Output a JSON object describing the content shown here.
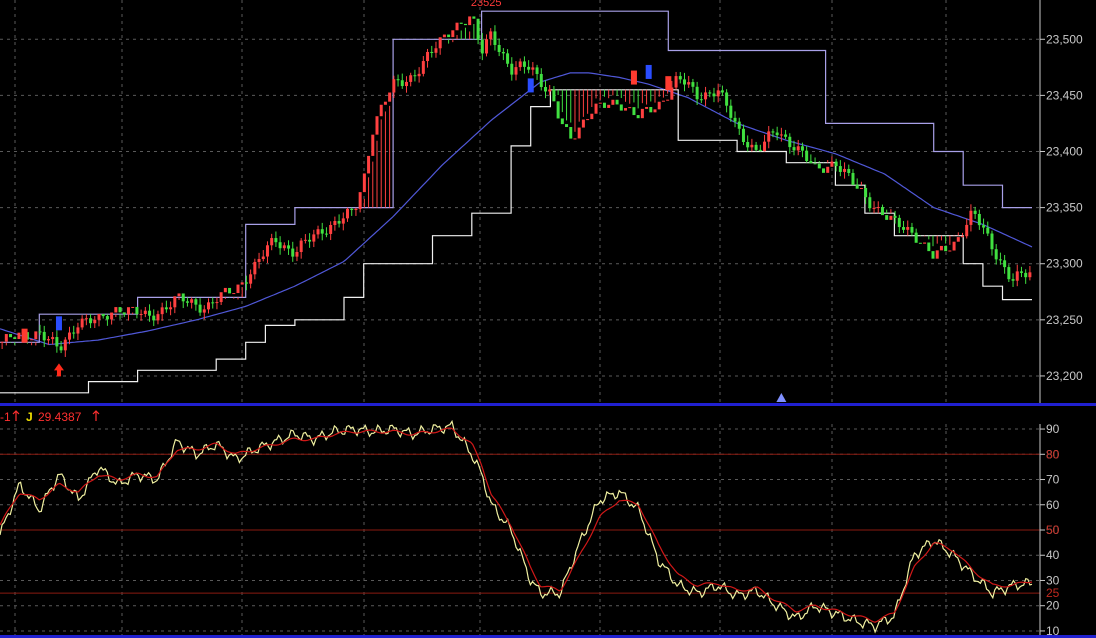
{
  "chart_data": [
    {
      "type": "candlestick",
      "panel": "price",
      "ylim": [
        23175,
        23535
      ],
      "yticks": [
        23200,
        23250,
        23300,
        23350,
        23400,
        23450,
        23500
      ],
      "ytick_labels": [
        "23,200",
        "23,250",
        "23,300",
        "23,350",
        "23,400",
        "23,450",
        "23,500"
      ],
      "x_range": [
        0,
        210
      ],
      "peak_label": "23525",
      "peak_point": [
        95,
        23525
      ],
      "series": [
        {
          "kind": "close_path",
          "x": [
            0,
            8,
            12,
            16,
            20,
            24,
            30,
            36,
            42,
            48,
            52,
            56,
            60,
            66,
            72,
            74,
            76,
            80,
            84,
            88,
            92,
            96,
            98,
            100,
            104,
            108,
            112,
            114,
            116,
            120,
            126,
            130,
            134,
            138,
            142,
            146,
            150,
            154,
            158,
            162,
            166,
            170,
            174,
            178,
            182,
            186,
            190,
            194,
            198,
            202,
            206,
            210
          ],
          "y": [
            23230,
            23240,
            23222,
            23250,
            23248,
            23262,
            23252,
            23268,
            23262,
            23278,
            23298,
            23322,
            23310,
            23332,
            23345,
            23375,
            23425,
            23458,
            23468,
            23488,
            23512,
            23518,
            23488,
            23508,
            23470,
            23478,
            23450,
            23425,
            23412,
            23435,
            23445,
            23430,
            23442,
            23465,
            23450,
            23455,
            23420,
            23400,
            23418,
            23405,
            23382,
            23392,
            23368,
            23352,
            23335,
            23328,
            23305,
            23318,
            23345,
            23315,
            23285,
            23292
          ]
        },
        {
          "kind": "upper_channel",
          "x": [
            0,
            8,
            28,
            50,
            60,
            80,
            98,
            132,
            136,
            166,
            168,
            190,
            196,
            204,
            210
          ],
          "y": [
            23230,
            23255,
            23270,
            23335,
            23350,
            23500,
            23525,
            23525,
            23490,
            23490,
            23425,
            23400,
            23370,
            23350,
            23350
          ]
        },
        {
          "kind": "lower_channel",
          "x": [
            0,
            18,
            28,
            44,
            50,
            54,
            60,
            70,
            74,
            88,
            96,
            104,
            108,
            112,
            114,
            138,
            148,
            150,
            160,
            170,
            176,
            182,
            196,
            200,
            204
          ],
          "y": [
            23185,
            23195,
            23205,
            23215,
            23230,
            23245,
            23250,
            23270,
            23300,
            23325,
            23345,
            23405,
            23440,
            23455,
            23455,
            23410,
            23410,
            23400,
            23390,
            23370,
            23345,
            23325,
            23300,
            23280,
            23268
          ]
        },
        {
          "kind": "moving_average",
          "x": [
            0,
            10,
            20,
            30,
            40,
            50,
            60,
            70,
            80,
            90,
            100,
            110,
            116,
            120,
            126,
            132,
            140,
            150,
            160,
            170,
            180,
            190,
            200,
            210
          ],
          "y": [
            23242,
            23228,
            23232,
            23240,
            23250,
            23262,
            23280,
            23302,
            23342,
            23388,
            23428,
            23462,
            23470,
            23470,
            23466,
            23460,
            23448,
            23425,
            23410,
            23398,
            23380,
            23350,
            23335,
            23315
          ]
        }
      ],
      "signals": [
        {
          "x": 5,
          "price": 23235,
          "color": "#ff3b30",
          "type": "bar"
        },
        {
          "x": 12,
          "price": 23246,
          "color": "#2a4dff",
          "type": "bar"
        },
        {
          "x": 12,
          "price": 23205,
          "color": "#ff2a1a",
          "type": "arrow"
        },
        {
          "x": 108,
          "price": 23458,
          "color": "#2a4dff",
          "type": "bar"
        },
        {
          "x": 129,
          "price": 23465,
          "color": "#ff3b30",
          "type": "bar"
        },
        {
          "x": 132,
          "price": 23470,
          "color": "#2a4dff",
          "type": "bar"
        },
        {
          "x": 136,
          "price": 23460,
          "color": "#ff3b30",
          "type": "bar"
        }
      ],
      "marker_x": 159
    },
    {
      "type": "line",
      "panel": "indicator",
      "ylim": [
        8,
        92
      ],
      "yticks": [
        10,
        20,
        30,
        40,
        50,
        60,
        70,
        80,
        90
      ],
      "ytick_labels": [
        "10",
        "20",
        "30",
        "40",
        "50",
        "60",
        "70",
        "80",
        "90"
      ],
      "reference_levels": [
        80,
        50,
        25
      ],
      "reference_labels": [
        "80",
        "50",
        "25"
      ],
      "x_range": [
        0,
        210
      ],
      "legend": [
        {
          "text": "-1",
          "color": "#ff3030"
        },
        {
          "text": "J",
          "color": "#f0e000"
        },
        {
          "text": "29.4387",
          "color": "#ff3030"
        }
      ],
      "series": [
        {
          "name": "J",
          "color": "#f0f0a0",
          "x": [
            0,
            4,
            8,
            12,
            16,
            20,
            24,
            28,
            32,
            36,
            40,
            44,
            48,
            52,
            56,
            60,
            64,
            68,
            72,
            76,
            80,
            84,
            88,
            92,
            96,
            98,
            100,
            104,
            108,
            110,
            114,
            118,
            122,
            126,
            130,
            134,
            138,
            142,
            146,
            150,
            154,
            158,
            162,
            166,
            170,
            174,
            178,
            182,
            186,
            190,
            194,
            198,
            202,
            206,
            210
          ],
          "y": [
            48,
            68,
            58,
            72,
            62,
            75,
            68,
            72,
            70,
            85,
            80,
            84,
            78,
            82,
            85,
            88,
            86,
            89,
            90,
            89,
            90,
            88,
            90,
            91,
            80,
            72,
            60,
            50,
            30,
            25,
            25,
            45,
            62,
            65,
            58,
            38,
            28,
            25,
            28,
            24,
            26,
            20,
            15,
            20,
            17,
            14,
            12,
            16,
            40,
            46,
            40,
            32,
            25,
            28,
            29
          ]
        },
        {
          "name": "K",
          "color": "#d01818",
          "x": [
            0,
            4,
            8,
            12,
            16,
            20,
            24,
            28,
            32,
            36,
            40,
            44,
            48,
            52,
            56,
            60,
            64,
            68,
            72,
            76,
            80,
            84,
            88,
            92,
            96,
            98,
            100,
            104,
            108,
            110,
            114,
            118,
            122,
            126,
            130,
            134,
            138,
            142,
            146,
            150,
            154,
            158,
            162,
            166,
            170,
            174,
            178,
            182,
            186,
            190,
            194,
            198,
            202,
            206,
            210
          ],
          "y": [
            52,
            65,
            62,
            68,
            65,
            72,
            70,
            72,
            71,
            82,
            82,
            84,
            80,
            82,
            84,
            86,
            86,
            88,
            89,
            89,
            89,
            88,
            89,
            90,
            84,
            76,
            64,
            52,
            35,
            28,
            26,
            40,
            55,
            62,
            60,
            44,
            32,
            28,
            29,
            26,
            27,
            22,
            18,
            20,
            18,
            16,
            14,
            17,
            35,
            45,
            42,
            34,
            28,
            28,
            30
          ]
        }
      ]
    }
  ]
}
